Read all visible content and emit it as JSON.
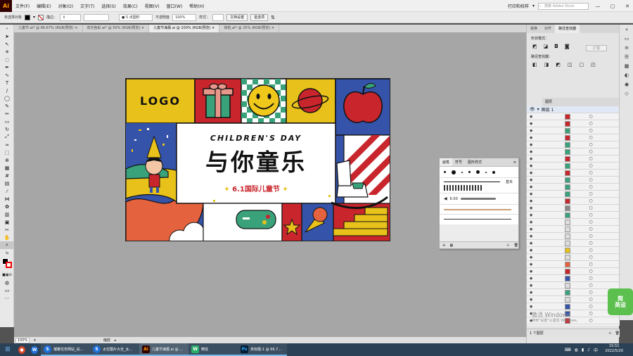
{
  "app": {
    "logo": "Ai"
  },
  "menu": {
    "items": [
      "文件(F)",
      "编辑(E)",
      "对象(O)",
      "文字(T)",
      "选择(S)",
      "效果(C)",
      "视图(V)",
      "窗口(W)",
      "帮助(H)"
    ]
  },
  "workspace": {
    "label": "打印和校样",
    "search_placeholder": "搜索 Adobe Stock"
  },
  "control_bar": {
    "selection": "未选择对象",
    "stroke_label": "描边：",
    "brush_size": "5 点圆形",
    "opacity_label": "不透明度",
    "opacity_value": "100%",
    "style_label": "样式：",
    "doc_setup": "文档设置",
    "preferences": "首选项"
  },
  "tabs": [
    {
      "label": "儿童节.ai* @ 66.67% (RGB/预览)",
      "active": false
    },
    {
      "label": "欢乐色彩.ai* @ 50% (RGB/预览)",
      "active": false
    },
    {
      "label": "儿童节海报.ai @ 100% (RGB/预览)",
      "active": true
    },
    {
      "label": "体检.ai* @ 25% (RGB/预览)",
      "active": false
    }
  ],
  "poster": {
    "logo": "LOGO",
    "subtitle": "CHILDREN'S DAY",
    "title": "与你童乐",
    "date_text": "6.1国际儿童节"
  },
  "status": {
    "zoom": "100%",
    "tool": "缩放"
  },
  "right_panel": {
    "tabs": [
      "变换",
      "对齐",
      "路径查找器"
    ],
    "shape_modes_label": "形状模式：",
    "expand_label": "扩展",
    "pathfinder_label": "路径查找器：",
    "layers_tab": "图层",
    "layers_label": "1 个图层",
    "layer_name": "图层 1"
  },
  "brush_panel": {
    "tabs": [
      "画笔",
      "符号",
      "图形样式"
    ],
    "basic_label": "基本",
    "size_value": "6.00"
  },
  "taskbar": {
    "items": [
      {
        "label": "凝聚任务网站_设...",
        "color": "#1f6fd8",
        "icon": "S"
      },
      {
        "label": "太空图片大全_太...",
        "color": "#1f6fd8",
        "icon": "S"
      },
      {
        "label": "儿童节海报.ai @ ...",
        "color": "#330000",
        "icon": "Ai"
      },
      {
        "label": "微信",
        "color": "#2aae67",
        "icon": "W"
      },
      {
        "label": "未标题-1 @ 66.7...",
        "color": "#001e36",
        "icon": "Ps"
      }
    ],
    "time": "15:51",
    "date": "2022/5/20"
  },
  "overlays": {
    "jianying": "简\n英设",
    "activate_line1": "激活 Windows",
    "activate_line2": "转到\"设置\"以激活 Windows。"
  },
  "colors": {
    "poster_yellow": "#e8c21a",
    "poster_red": "#c8262c",
    "poster_blue": "#3553a8",
    "poster_green": "#3aa27a",
    "poster_orange": "#e4623e"
  }
}
